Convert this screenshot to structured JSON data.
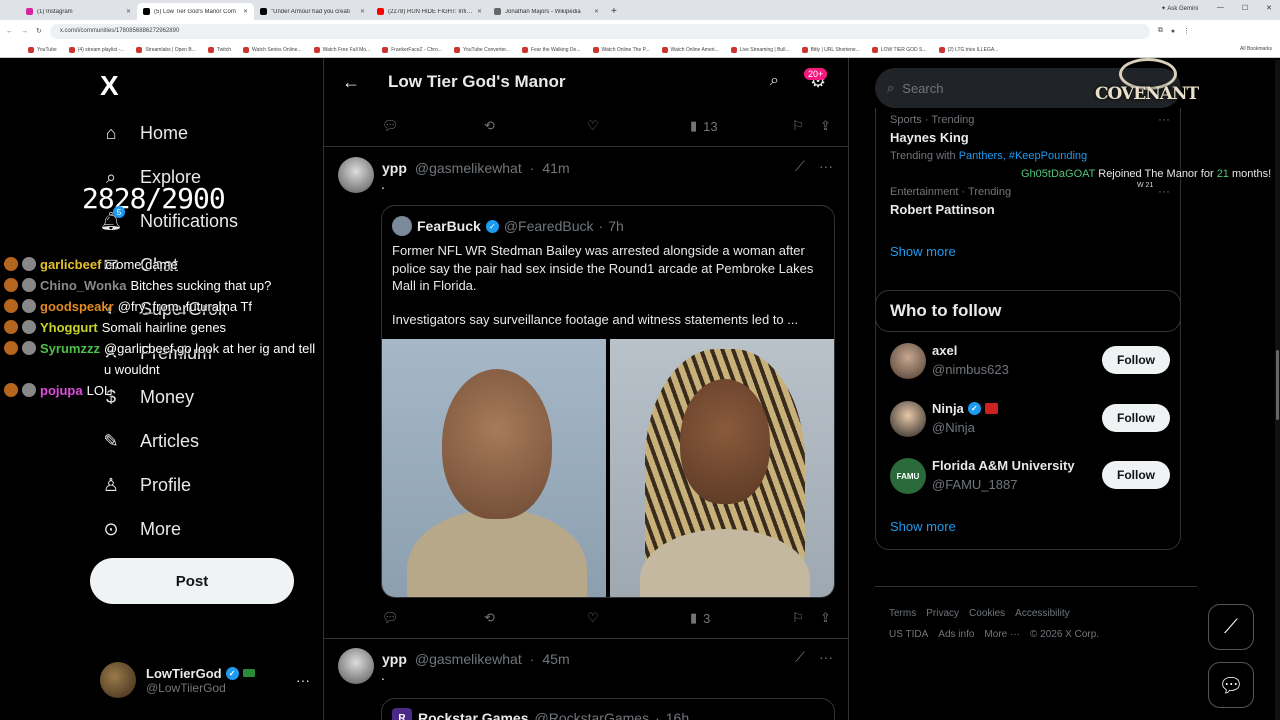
{
  "browser": {
    "tabs": [
      {
        "label": "(1) Instagram",
        "color": "#d6249f",
        "active": false
      },
      {
        "label": "(5) Low Tier God's Manor Com",
        "color": "#000000",
        "active": true
      },
      {
        "label": "\"Under Armour had you creati",
        "color": "#000000",
        "active": false
      },
      {
        "label": "(2278) RUN HIDE FIGHT: Infide",
        "color": "#ff0000",
        "active": false
      },
      {
        "label": "Jonathan Majors - Wikipedia",
        "color": "#666666",
        "active": false
      }
    ],
    "new_tab": "+",
    "ask_gemini": "Ask Gemini",
    "url": "x.com/i/communities/1780856886272962890",
    "bookmarks": [
      "YouTube",
      "(4) stream playlist -...",
      "Streamlabs | Open B...",
      "Twitch",
      "Watch Series Online...",
      "Watch Free Full Mo...",
      "FrankerFaceZ - Chro...",
      "YouTube Converter...",
      "Fear the Walking De...",
      "Watch Online The P...",
      "Watch Online Ameri...",
      "Live Streaming | Bull...",
      "Bitly | URL Shortene...",
      "LOW TIER GOD S...",
      "(2) LTG tries ILLEGA..."
    ],
    "all_bookmarks": "All Bookmarks"
  },
  "nav": {
    "logo": "X",
    "items": [
      {
        "label": "Home",
        "icon": "home-icon"
      },
      {
        "label": "Explore",
        "icon": "search-icon"
      },
      {
        "label": "Notifications",
        "icon": "bell-icon"
      },
      {
        "label": "Chat",
        "icon": "chat-icon"
      },
      {
        "label": "SuperGrok",
        "icon": "grok-icon"
      },
      {
        "label": "Premium",
        "icon": "x-premium-icon"
      },
      {
        "label": "Money",
        "icon": "money-icon"
      },
      {
        "label": "Articles",
        "icon": "articles-icon"
      },
      {
        "label": "Profile",
        "icon": "profile-icon"
      },
      {
        "label": "More",
        "icon": "more-circle-icon"
      }
    ],
    "notif_badge": "5",
    "post_button": "Post",
    "account": {
      "name": "LowTierGod",
      "handle": "@LowTiierGod"
    }
  },
  "overlay": {
    "counter": "2828/2900",
    "chat": [
      {
        "user": "garlicbeef",
        "color": "#e7c12a",
        "msg": "crome dame"
      },
      {
        "user": "Chino_Wonka",
        "color": "#8a8a8a",
        "msg": "Bitches sucking that up?"
      },
      {
        "user": "goodspeakr",
        "color": "#e28a1e",
        "msg": "@fry_from_futurama Tf"
      },
      {
        "user": "Yhoggurt",
        "color": "#c8d42a",
        "msg": "Somali hairline genes"
      },
      {
        "user": "Syrumzzz",
        "color": "#4fc14a",
        "msg": "@garlicbeef go look at her ig and tell u wouldnt"
      },
      {
        "user": "pojupa",
        "color": "#e34ce0",
        "msg": "LOL"
      }
    ],
    "covenant": "COVENANT",
    "rejoin": {
      "user": "Gh05tDaGOAT",
      "text1": "Rejoined The Manor for",
      "months": "21",
      "text2": "months!",
      "small": "W 21"
    }
  },
  "center": {
    "title": "Low Tier God's Manor",
    "notif_pill": "20+",
    "prev_views": "13",
    "tweet1": {
      "name": "ypp",
      "handle": "@gasmelikewhat",
      "time": "41m",
      "text": ".",
      "quote": {
        "name": "FearBuck",
        "handle": "@FearedBuck",
        "time": "7h",
        "text": "Former NFL WR Stedman Bailey was arrested alongside a woman after police say the pair had sex inside the Round1 arcade at Pembroke Lakes Mall in Florida.",
        "text2": "Investigators say surveillance footage and witness statements led to ..."
      },
      "views": "3"
    },
    "tweet2": {
      "name": "ypp",
      "handle": "@gasmelikewhat",
      "time": "45m",
      "text": ".",
      "quote": {
        "name": "Rockstar Games",
        "handle": "@RockstarGames",
        "time": "16h",
        "icon": "R"
      }
    }
  },
  "right": {
    "search_placeholder": "Search",
    "trends": [
      {
        "cat": "Sports · Trending",
        "name": "Haynes King",
        "with_label": "Trending with",
        "with_links": "Panthers, #KeepPounding"
      },
      {
        "cat": "Entertainment · Trending",
        "name": "Robert Pattinson"
      }
    ],
    "show_more": "Show more",
    "who_title": "Who to follow",
    "who": [
      {
        "name": "axel",
        "handle": "@nimbus623",
        "verified": false
      },
      {
        "name": "Ninja",
        "handle": "@Ninja",
        "verified": true
      },
      {
        "name": "Florida A&M University",
        "handle": "@FAMU_1887",
        "verified": false
      }
    ],
    "follow": "Follow",
    "footer": [
      "Terms",
      "Privacy",
      "Cookies",
      "Accessibility",
      "US TIDA",
      "Ads info",
      "More ···",
      "© 2026 X Corp."
    ]
  },
  "colors": {
    "accent": "#1d9bf0",
    "background": "#000000",
    "border": "#2f3336",
    "muted": "#71767b"
  }
}
